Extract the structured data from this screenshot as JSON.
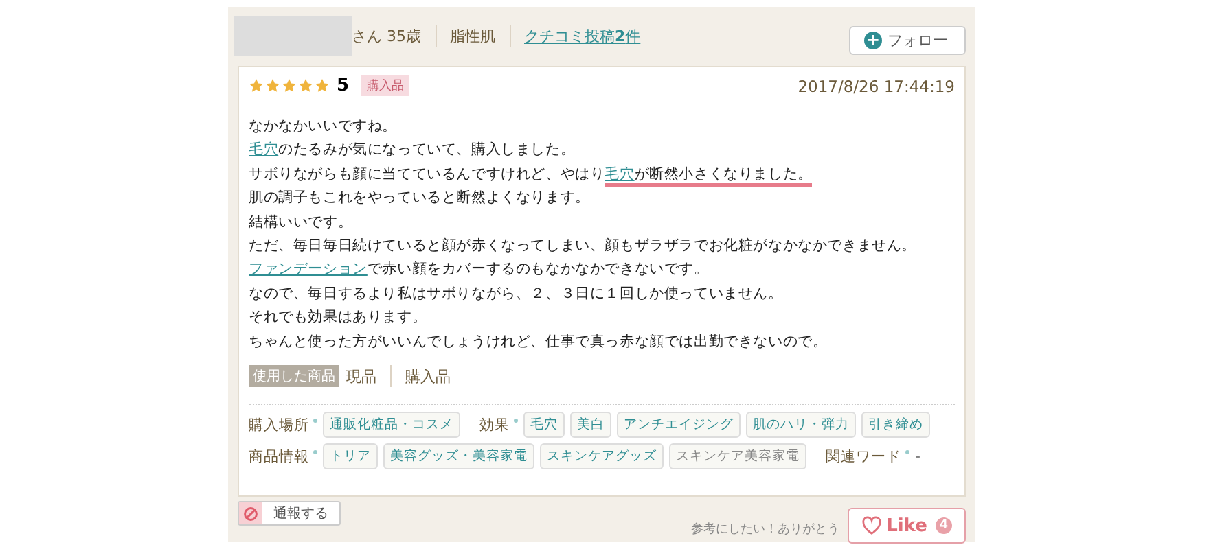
{
  "reviewer": {
    "suffix": "さん",
    "age": "35歳",
    "skin_type": "脂性肌",
    "posts_link": {
      "prefix": "クチコミ投稿",
      "count": "2",
      "suffix": "件"
    }
  },
  "follow_button": {
    "icon": "+",
    "label": "フォロー"
  },
  "review": {
    "stars": 5,
    "rating": "5",
    "badge": "購入品",
    "date": "2017/8/26 17:44:19",
    "paragraphs": [
      [
        {
          "kind": "text",
          "text": "なかなかいいですね。"
        }
      ],
      [
        {
          "kind": "link",
          "text": "毛穴"
        },
        {
          "kind": "text",
          "text": "のたるみが気になっていて、購入しました。"
        }
      ],
      [
        {
          "kind": "text",
          "text": "サボりながらも顔に当てているんですけれど、やはり"
        },
        {
          "kind": "highlight-link",
          "text": "毛穴"
        },
        {
          "kind": "highlight",
          "text": "が断然小さくなりました。"
        }
      ],
      [
        {
          "kind": "text",
          "text": "肌の調子もこれをやっていると断然よくなります。"
        }
      ],
      [
        {
          "kind": "text",
          "text": "結構いいです。"
        }
      ],
      [
        {
          "kind": "text",
          "text": "ただ、毎日毎日続けていると顔が赤くなってしまい、顔もザラザラでお化粧がなかなかできません。"
        },
        {
          "kind": "link",
          "text": "ファンデーション"
        },
        {
          "kind": "text",
          "text": "で赤い顔をカバーするのもなかなかできないです。"
        }
      ],
      [
        {
          "kind": "text",
          "text": "なので、毎日するより私はサボりながら、２、３日に１回しか使っていません。"
        }
      ],
      [
        {
          "kind": "text",
          "text": "それでも効果はあります。"
        }
      ],
      [
        {
          "kind": "text",
          "text": "ちゃんと使った方がいいんでしょうけれど、仕事で真っ赤な顔では出勤できないので。"
        }
      ]
    ],
    "product_label": "使用した商品",
    "product_items": [
      "現品",
      "購入品"
    ],
    "tag_rows": [
      [
        {
          "label": "購入場所",
          "tags": [
            {
              "text": "通販化粧品・コスメ",
              "muted": false
            }
          ]
        },
        {
          "label": "効果",
          "tags": [
            {
              "text": "毛穴",
              "muted": false
            },
            {
              "text": "美白",
              "muted": false
            },
            {
              "text": "アンチエイジング",
              "muted": false
            },
            {
              "text": "肌のハリ・弾力",
              "muted": false
            },
            {
              "text": "引き締め",
              "muted": false
            }
          ]
        }
      ],
      [
        {
          "label": "商品情報",
          "tags": [
            {
              "text": "トリア",
              "muted": false
            },
            {
              "text": "美容グッズ・美容家電",
              "muted": false
            },
            {
              "text": "スキンケアグッズ",
              "muted": false
            },
            {
              "text": "スキンケア美容家電",
              "muted": true
            }
          ]
        },
        {
          "label": "関連ワード",
          "value": "-"
        }
      ]
    ]
  },
  "report_button": {
    "label": "通報する"
  },
  "like": {
    "caption": "参考にしたい！ありがとう",
    "label": "Like",
    "count": "4"
  }
}
